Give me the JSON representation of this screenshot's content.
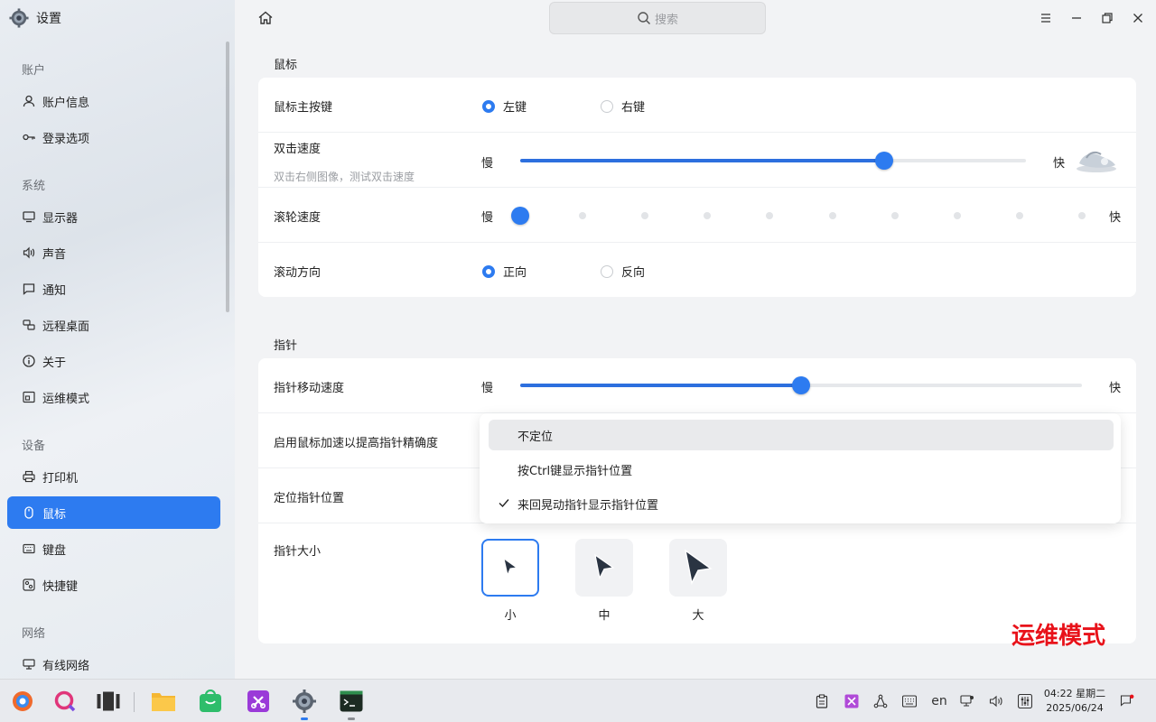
{
  "app": {
    "title": "设置"
  },
  "search": {
    "placeholder": "搜索"
  },
  "sidebar": {
    "groups": {
      "account": "账户",
      "system": "系统",
      "device": "设备",
      "network": "网络"
    },
    "items": [
      {
        "label": "账户信息",
        "icon": "user-icon"
      },
      {
        "label": "登录选项",
        "icon": "key-icon"
      },
      {
        "label": "显示器",
        "icon": "monitor-icon"
      },
      {
        "label": "声音",
        "icon": "speaker-icon"
      },
      {
        "label": "通知",
        "icon": "message-icon"
      },
      {
        "label": "远程桌面",
        "icon": "remote-icon"
      },
      {
        "label": "关于",
        "icon": "info-icon"
      },
      {
        "label": "运维模式",
        "icon": "ops-icon"
      },
      {
        "label": "打印机",
        "icon": "printer-icon"
      },
      {
        "label": "鼠标",
        "icon": "mouse-icon"
      },
      {
        "label": "键盘",
        "icon": "keyboard-icon"
      },
      {
        "label": "快捷键",
        "icon": "shortcut-icon"
      },
      {
        "label": "有线网络",
        "icon": "wired-network-icon"
      }
    ]
  },
  "mouse": {
    "section_title": "鼠标",
    "primary": {
      "label": "鼠标主按键",
      "options": [
        "左键",
        "右键"
      ],
      "selected": 0
    },
    "double_click": {
      "label": "双击速度",
      "sub": "双击右侧图像，测试双击速度",
      "slow": "慢",
      "fast": "快",
      "value": 0.72
    },
    "wheel": {
      "label": "滚轮速度",
      "slow": "慢",
      "fast": "快",
      "value": 0.0,
      "steps": 10
    },
    "scroll_dir": {
      "label": "滚动方向",
      "options": [
        "正向",
        "反向"
      ],
      "selected": 0
    }
  },
  "pointer": {
    "section_title": "指针",
    "speed": {
      "label": "指针移动速度",
      "slow": "慢",
      "fast": "快",
      "value": 0.5
    },
    "accel": {
      "label": "启用鼠标加速以提高指针精确度"
    },
    "locate": {
      "label": "定位指针位置"
    },
    "locate_options": [
      "不定位",
      "按Ctrl键显示指针位置",
      "来回晃动指针显示指针位置"
    ],
    "locate_checked": 2,
    "size": {
      "label": "指针大小",
      "options": [
        "小",
        "中",
        "大"
      ],
      "selected": 0
    }
  },
  "watermark": "运维模式",
  "taskbar": {
    "tray_lang": "en",
    "time": "04:22 星期二",
    "date": "2025/06/24"
  },
  "colors": {
    "accent": "#2d7bf0",
    "watermark": "#e8121a"
  }
}
